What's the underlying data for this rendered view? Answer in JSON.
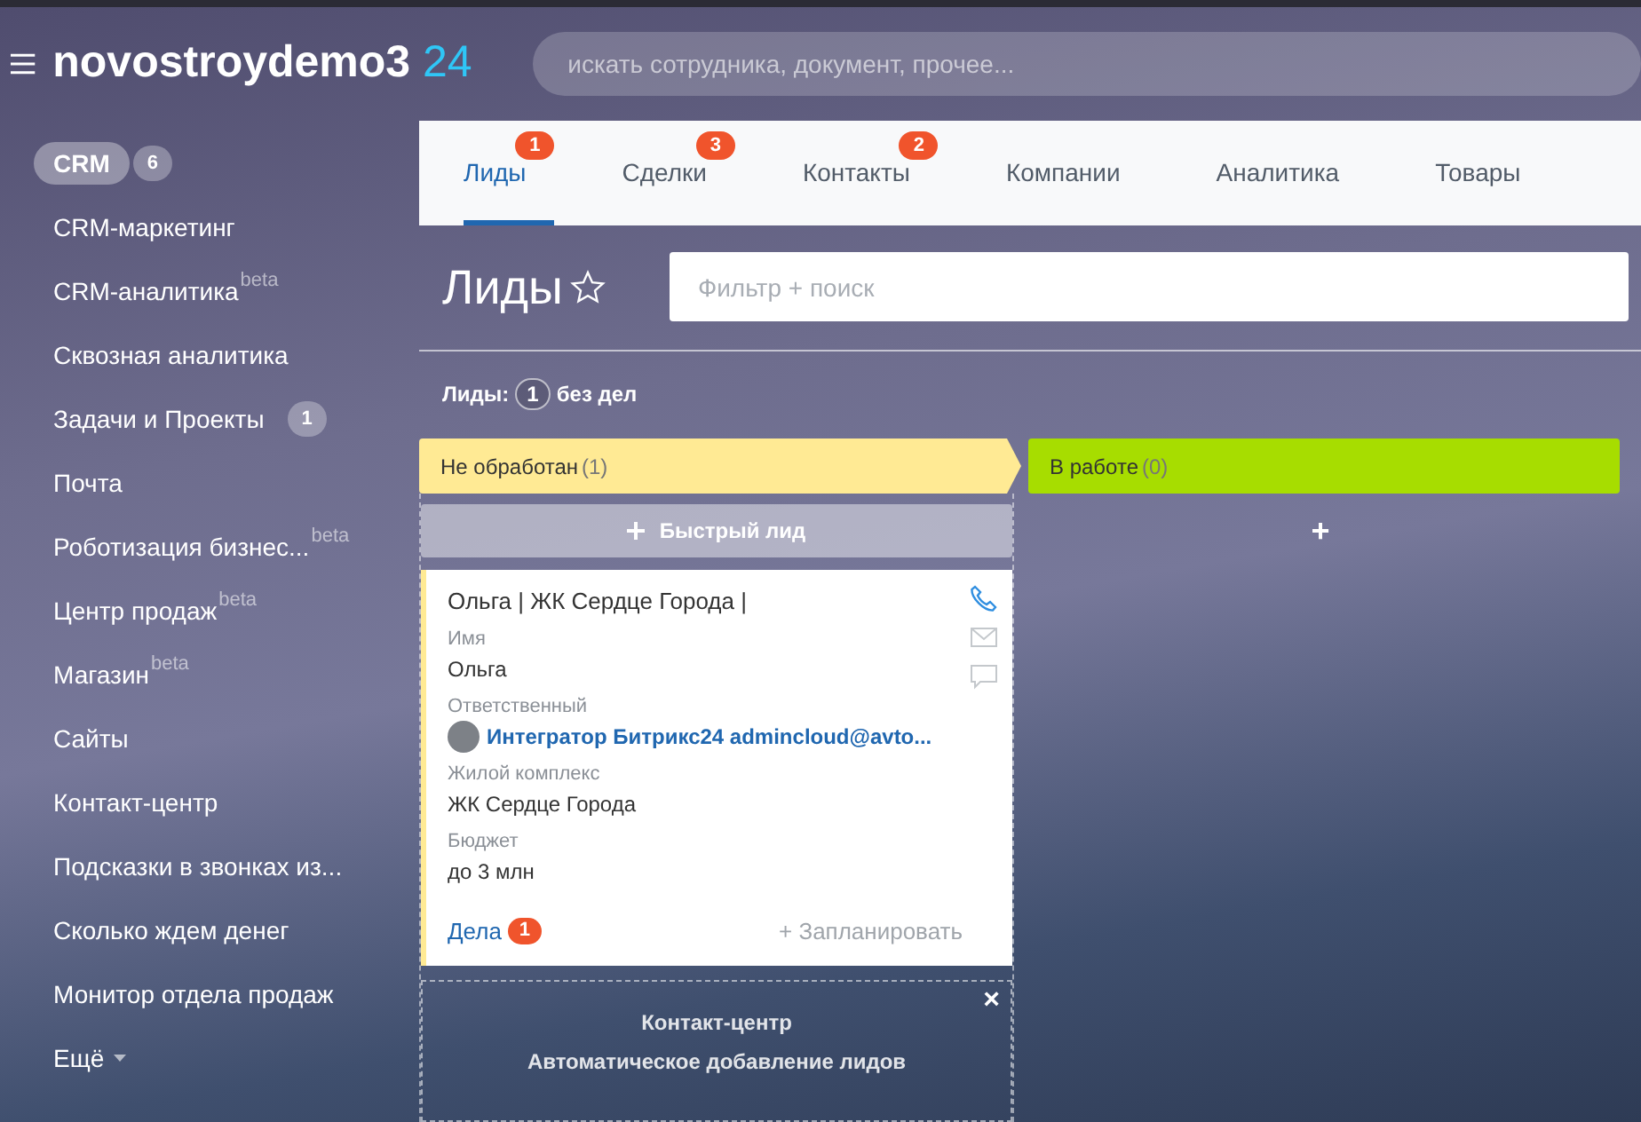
{
  "header": {
    "logo_name": "novostroydemo3",
    "logo_suffix": "24",
    "search": {
      "placeholder": "искать сотрудника, документ, прочее..."
    }
  },
  "sidebar": {
    "items": [
      {
        "label": "CRM",
        "selected": true,
        "badge": "6"
      },
      {
        "label": "CRM-маркетинг",
        "selected": false
      },
      {
        "label": "CRM-аналитика",
        "selected": false,
        "tag": "beta"
      },
      {
        "label": "Сквозная аналитика",
        "selected": false
      },
      {
        "label": "Задачи и Проекты",
        "selected": false,
        "badge": "1"
      },
      {
        "label": "Почта",
        "selected": false
      },
      {
        "label": "Роботизация бизнес...",
        "selected": false,
        "tag": "beta"
      },
      {
        "label": "Центр продаж",
        "selected": false,
        "tag": "beta"
      },
      {
        "label": "Магазин",
        "selected": false,
        "tag": "beta"
      },
      {
        "label": "Сайты",
        "selected": false
      },
      {
        "label": "Контакт-центр",
        "selected": false
      },
      {
        "label": "Подсказки в звонках из...",
        "selected": false
      },
      {
        "label": "Сколько ждем денег",
        "selected": false
      },
      {
        "label": "Монитор отдела продаж",
        "selected": false
      },
      {
        "label": "Ещё",
        "selected": false,
        "dropdown": true
      }
    ]
  },
  "tabs": [
    {
      "label": "Лиды",
      "selected": true,
      "counter": "1"
    },
    {
      "label": "Сделки",
      "selected": false,
      "counter": "3"
    },
    {
      "label": "Контакты",
      "selected": false,
      "counter": "2"
    },
    {
      "label": "Компании",
      "selected": false
    },
    {
      "label": "Аналитика",
      "selected": false
    },
    {
      "label": "Товары",
      "selected": false
    }
  ],
  "page": {
    "title": "Лиды",
    "filter": {
      "placeholder": "Фильтр + поиск"
    },
    "summary": {
      "label": "Лиды:",
      "count": "1",
      "suffix": "без дел"
    }
  },
  "columns": [
    {
      "title": "Не обработан",
      "count": "(1)",
      "color": "#ffea94",
      "quick_add": "Быстрый лид",
      "cards": [
        {
          "title": "Ольга | ЖК Сердце Города |",
          "fields": [
            {
              "kind": "text",
              "label": "Имя",
              "value": "Ольга"
            },
            {
              "kind": "user",
              "label": "Ответственный",
              "value": "Интегратор Битрикс24 admincloud@avto..."
            },
            {
              "kind": "text",
              "label": "Жилой комплекс",
              "value": "ЖК Сердце Города"
            },
            {
              "kind": "text",
              "label": "Бюджет",
              "value": "до 3 млн"
            }
          ],
          "activities": "Дела",
          "activities_count": "1",
          "plan": "+ Запланировать"
        }
      ],
      "promo": {
        "title": "Контакт-центр",
        "subtitle": "Автоматическое добавление лидов",
        "close": "×"
      }
    },
    {
      "title": "В работе",
      "count": "(0)",
      "color": "#a7dd00",
      "quick_add": "+"
    }
  ]
}
